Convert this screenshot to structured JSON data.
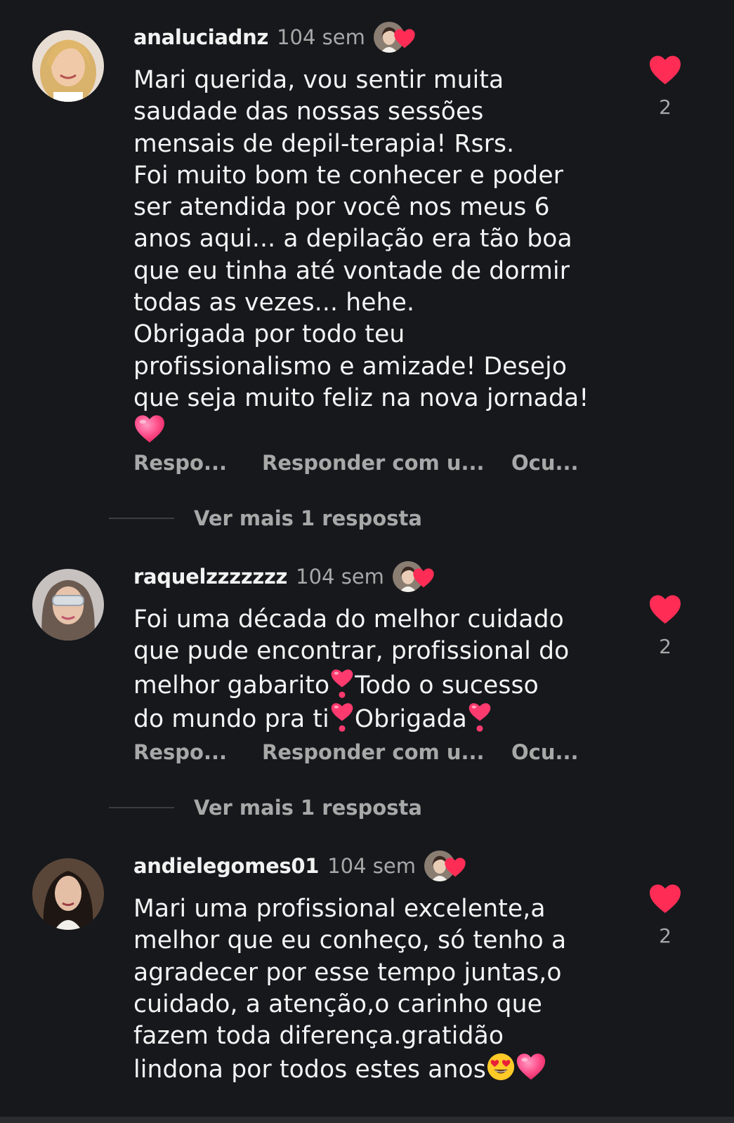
{
  "colors": {
    "background": "#16181c",
    "text": "#f4f4f4",
    "muted": "#a8a8a8",
    "heart_red": "#ff2d55",
    "pink_heart": "#ff4f8b"
  },
  "comments": [
    {
      "username": "analuciadnz",
      "time": "104 sem",
      "text": "Mari querida, vou sentir muita\nsaudade das nossas sessões\nmensais de depil-terapia! Rsrs.\nFoi muito bom te conhecer e poder\nser atendida por você nos meus 6\nanos aqui... a depilação era tão boa\nque eu tinha até vontade de dormir\ntodas as vezes... hehe.\nObrigada por todo teu\nprofissionalismo e amizade! Desejo\nque seja muito feliz na nova jornada!",
      "likes": "2",
      "actions": {
        "reply": "Respo...",
        "reply_with": "Responder com u...",
        "hide": "Ocu..."
      },
      "more_replies": "Ver mais 1 resposta"
    },
    {
      "username": "raquelzzzzzzz",
      "time": "104 sem",
      "text_parts": [
        "Foi uma década do melhor cuidado\nque pude encontrar, profissional do\nmelhor gabarito",
        "Todo o sucesso\ndo mundo pra ti",
        "Obrigada"
      ],
      "likes": "2",
      "actions": {
        "reply": "Respo...",
        "reply_with": "Responder com u...",
        "hide": "Ocu..."
      },
      "more_replies": "Ver mais 1 resposta"
    },
    {
      "username": "andielegomes01",
      "time": "104 sem",
      "text": "Mari uma profissional excelente,a\nmelhor que eu conheço, só tenho a\nagradecer por esse tempo juntas,o\ncuidado, a atenção,o carinho que\nfazem toda diferença.gratidão\nlindona por todos estes anos",
      "likes": "2"
    }
  ],
  "icons": {
    "like": "heart-icon",
    "author_like": "author-liked-badge",
    "emoji_pink_heart": "pink-heart-emoji",
    "emoji_heart_exclamation": "heart-exclamation-emoji",
    "emoji_heart_eyes": "heart-eyes-emoji"
  }
}
